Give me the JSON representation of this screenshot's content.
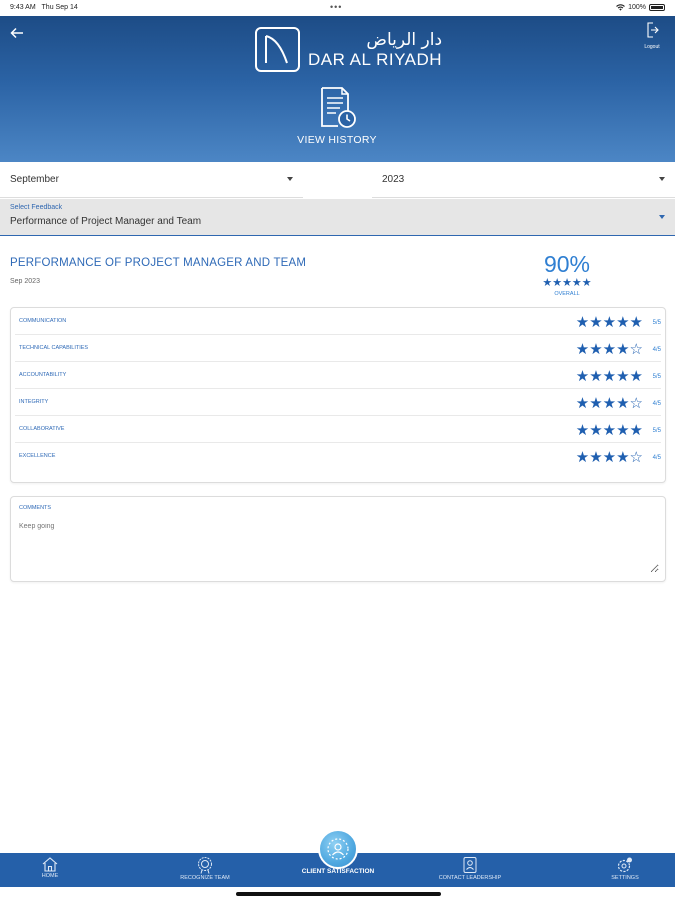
{
  "status_bar": {
    "time": "9:43 AM",
    "date": "Thu Sep 14",
    "battery": "100%"
  },
  "header": {
    "logo_arabic": "دار الرياض",
    "logo_english": "DAR AL RIYADH",
    "logout_label": "Logout",
    "view_history_label": "VIEW HISTORY"
  },
  "filters": {
    "month": "September",
    "year": "2023",
    "feedback_label": "Select Feedback",
    "feedback_value": "Performance of Project Manager and Team"
  },
  "summary": {
    "title": "PERFORMANCE OF PROJECT MANAGER AND TEAM",
    "date": "Sep 2023",
    "overall_percent": "90%",
    "overall_stars": "★★★★★",
    "overall_label": "OVERALL"
  },
  "ratings": [
    {
      "label": "COMMUNICATION",
      "stars": "★★★★★",
      "score": "5/5",
      "value": 5
    },
    {
      "label": "TECHNICAL CAPABILITIES",
      "stars": "★★★★☆",
      "score": "4/5",
      "value": 4
    },
    {
      "label": "ACCOUNTABILITY",
      "stars": "★★★★★",
      "score": "5/5",
      "value": 5
    },
    {
      "label": "INTEGRITY",
      "stars": "★★★★☆",
      "score": "4/5",
      "value": 4
    },
    {
      "label": "COLLABORATIVE",
      "stars": "★★★★★",
      "score": "5/5",
      "value": 5
    },
    {
      "label": "EXCELLENCE",
      "stars": "★★★★☆",
      "score": "4/5",
      "value": 4
    }
  ],
  "comments": {
    "label": "COMMENTS",
    "placeholder": "Keep going"
  },
  "bottom_nav": {
    "home": "HOME",
    "recognize_team": "RECOGNIZE TEAM",
    "client_satisfaction": "CLIENT SATISFACTION",
    "contact_leadership": "CONTACT LEADERSHIP",
    "settings": "SETTINGS"
  },
  "colors": {
    "primary": "#2560a9",
    "accent": "#2f7fd2",
    "star": "#1f5fb0"
  }
}
